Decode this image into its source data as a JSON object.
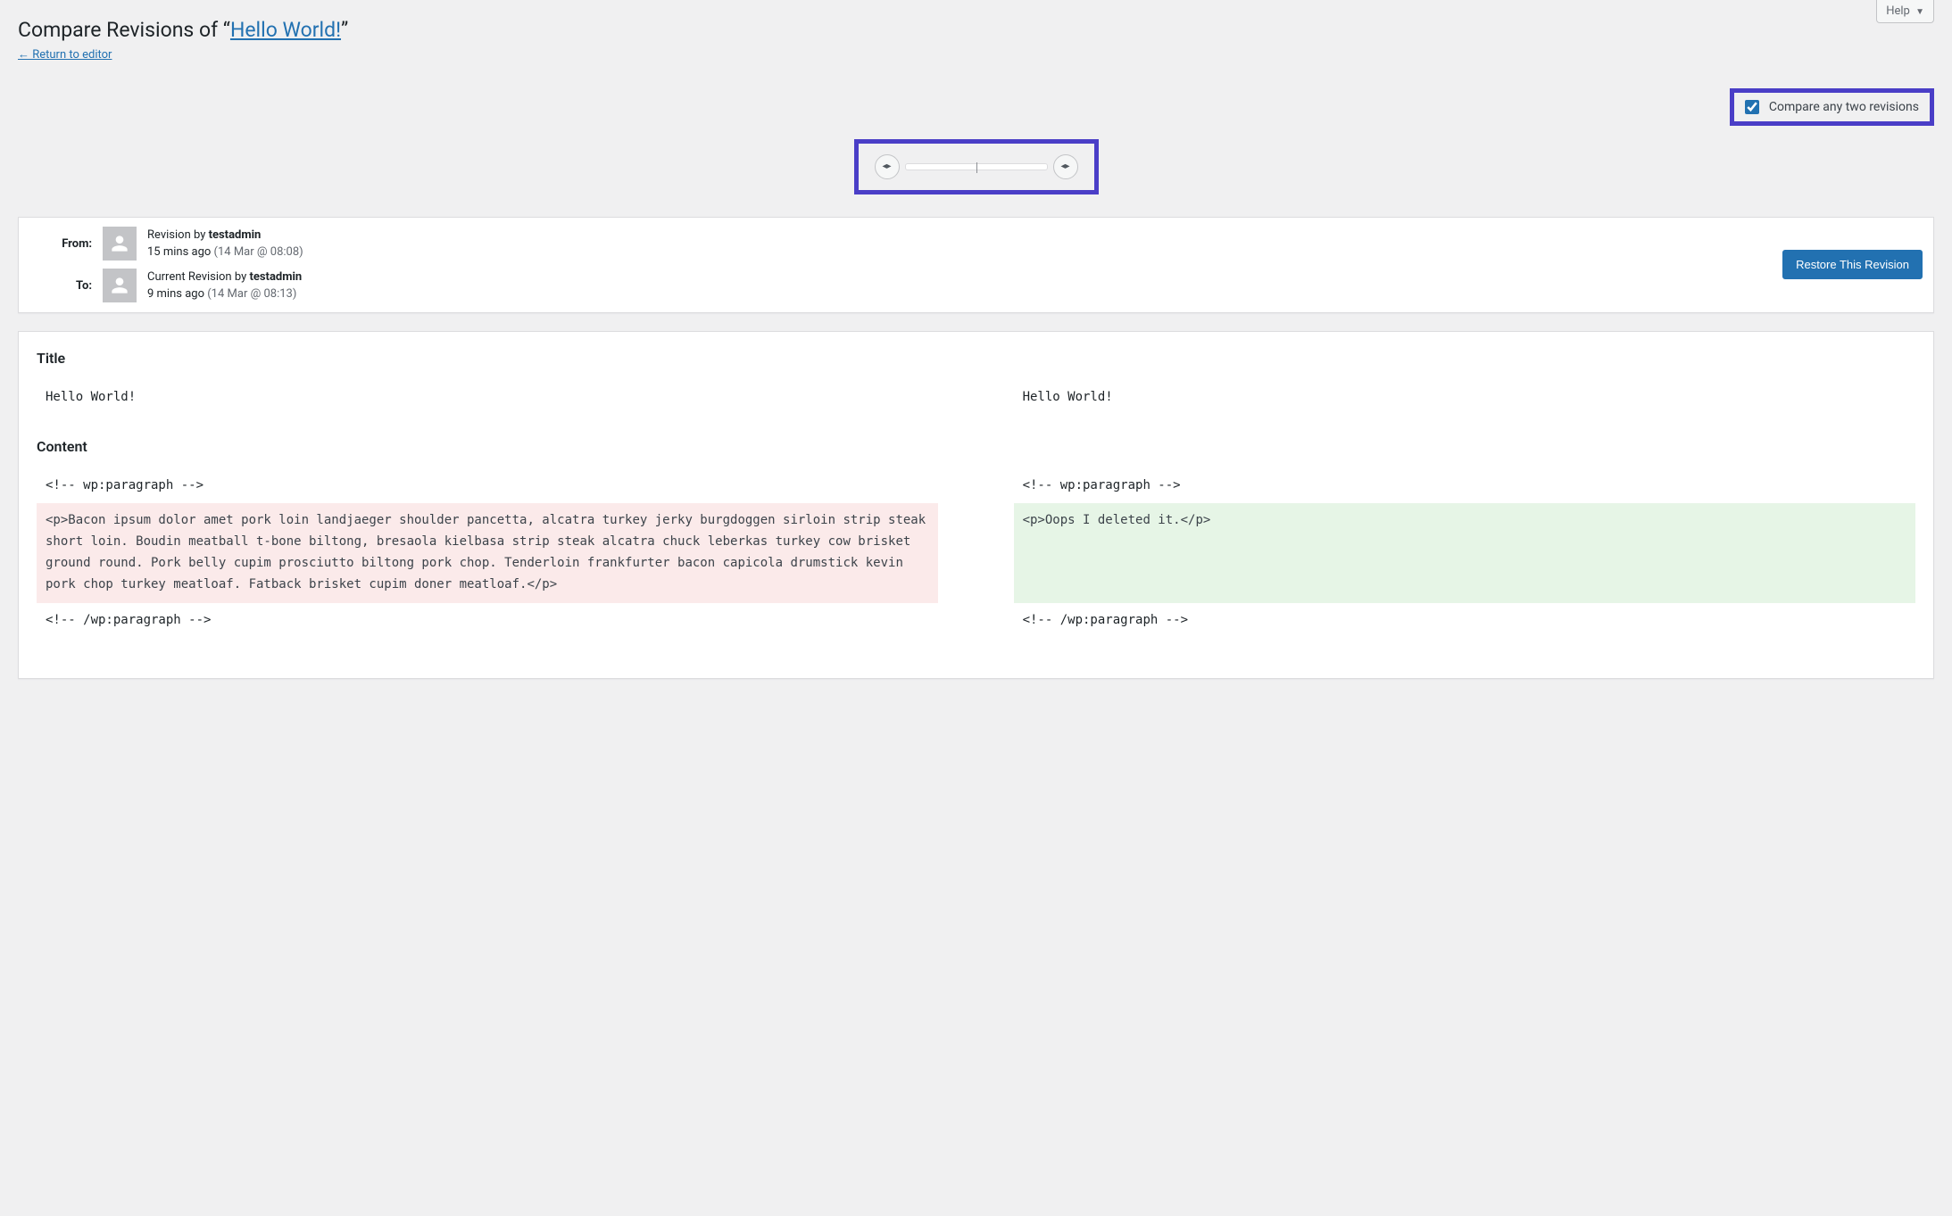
{
  "help_label": "Help",
  "page_title_prefix": "Compare Revisions of “",
  "page_title_link": "Hello World!",
  "page_title_suffix": "”",
  "return_link": "← Return to editor",
  "compare_two_label": "Compare any two revisions",
  "compare_two_checked": true,
  "from": {
    "label": "From:",
    "revision_prefix": "Revision by ",
    "author": "testadmin",
    "time_ago": "15 mins ago",
    "timestamp": "(14 Mar @ 08:08)"
  },
  "to": {
    "label": "To:",
    "revision_prefix": "Current Revision by ",
    "author": "testadmin",
    "time_ago": "9 mins ago",
    "timestamp": "(14 Mar @ 08:13)"
  },
  "restore_button": "Restore This Revision",
  "diff": {
    "title_heading": "Title",
    "title_from": "Hello World!",
    "title_to": "Hello World!",
    "content_heading": "Content",
    "rows": [
      {
        "type": "context",
        "from": "<!-- wp:paragraph -->",
        "to": "<!-- wp:paragraph -->"
      },
      {
        "type": "change",
        "from": "<p>Bacon ipsum dolor amet pork loin landjaeger shoulder pancetta, alcatra turkey jerky burgdoggen sirloin strip steak short loin. Boudin meatball t-bone biltong, bresaola kielbasa strip steak alcatra chuck leberkas turkey cow brisket ground round. Pork belly cupim prosciutto biltong pork chop. Tenderloin frankfurter bacon capicola drumstick kevin pork chop turkey meatloaf. Fatback brisket cupim doner meatloaf.</p>",
        "to": "<p>Oops I deleted it.</p>"
      },
      {
        "type": "context",
        "from": "<!-- /wp:paragraph -->",
        "to": "<!-- /wp:paragraph -->"
      }
    ]
  }
}
